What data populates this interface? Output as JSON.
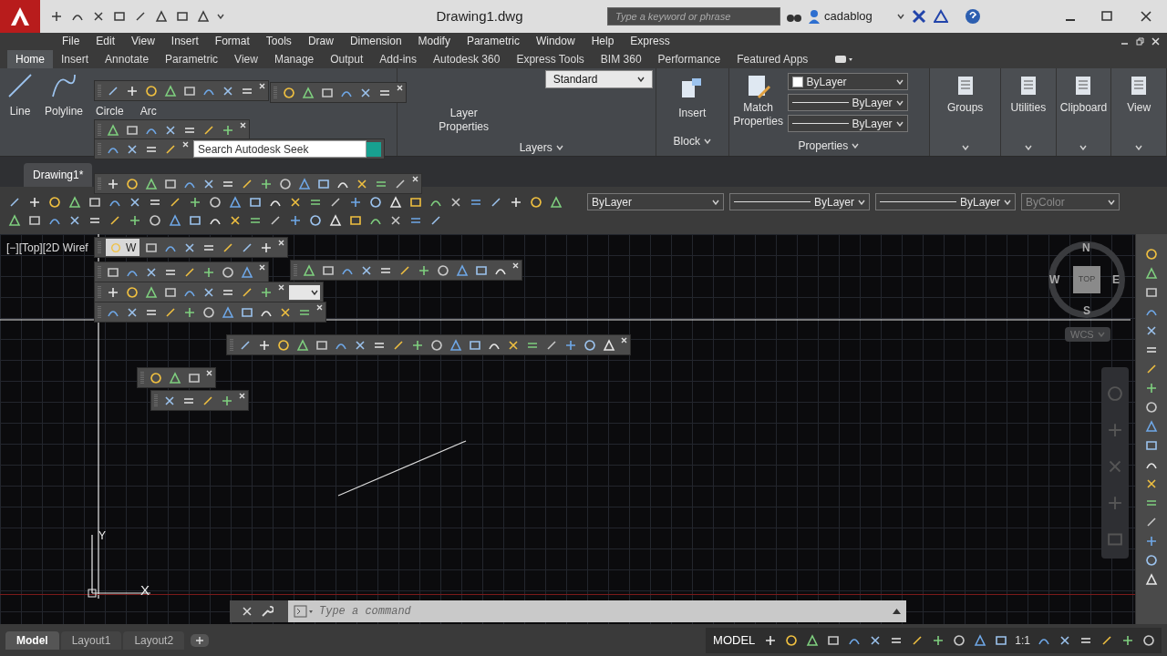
{
  "title_bar": {
    "title": "Drawing1.dwg",
    "search": {
      "placeholder": "Type a keyword or phrase"
    },
    "user": "cadablog"
  },
  "menu_bar": [
    "File",
    "Edit",
    "View",
    "Insert",
    "Format",
    "Tools",
    "Draw",
    "Dimension",
    "Modify",
    "Parametric",
    "Window",
    "Help",
    "Express"
  ],
  "ribbon_tabs": [
    {
      "label": "Home",
      "selected": true
    },
    {
      "label": "Insert",
      "selected": false
    },
    {
      "label": "Annotate",
      "selected": false
    },
    {
      "label": "Parametric",
      "selected": false
    },
    {
      "label": "View",
      "selected": false
    },
    {
      "label": "Manage",
      "selected": false
    },
    {
      "label": "Output",
      "selected": false
    },
    {
      "label": "Add-ins",
      "selected": false
    },
    {
      "label": "Autodesk 360",
      "selected": false
    },
    {
      "label": "Express Tools",
      "selected": false
    },
    {
      "label": "BIM 360",
      "selected": false
    },
    {
      "label": "Performance",
      "selected": false
    },
    {
      "label": "Featured Apps",
      "selected": false
    }
  ],
  "ribbon": {
    "draw_tools": [
      "Line",
      "Polyline",
      "Circle",
      "Arc"
    ],
    "text_style": "Standard",
    "layer_tool": "Layer Properties",
    "layers_panel": "Layers",
    "insert_tool": "Insert",
    "block_panel": "Block",
    "match_tool": "Match Properties",
    "property_dropdowns": [
      "ByLayer",
      "ByLayer",
      "ByLayer"
    ],
    "properties_panel": "Properties",
    "panels": [
      "Groups",
      "Utilities",
      "Clipboard",
      "View"
    ]
  },
  "seek_search": {
    "placeholder": "Search Autodesk Seek"
  },
  "file_tabs": [
    {
      "label": "Drawing1*",
      "selected": true
    }
  ],
  "property_toolbar": [
    "ByLayer",
    "ByLayer",
    "ByLayer",
    "ByColor"
  ],
  "workspace_label": "W",
  "viewport": {
    "label": "[−][Top][2D Wiref",
    "viewcube": {
      "north": "N",
      "south": "S",
      "east": "E",
      "west": "W",
      "face": "TOP"
    },
    "ucs": "WCS",
    "ucs_axes": {
      "x": "X",
      "y": "Y"
    }
  },
  "command_line": {
    "placeholder": "Type a command"
  },
  "layout_tabs": [
    {
      "label": "Model",
      "selected": true
    },
    {
      "label": "Layout1",
      "selected": false
    },
    {
      "label": "Layout2",
      "selected": false
    }
  ],
  "status_bar": {
    "mode": "MODEL",
    "scale": "1:1"
  }
}
